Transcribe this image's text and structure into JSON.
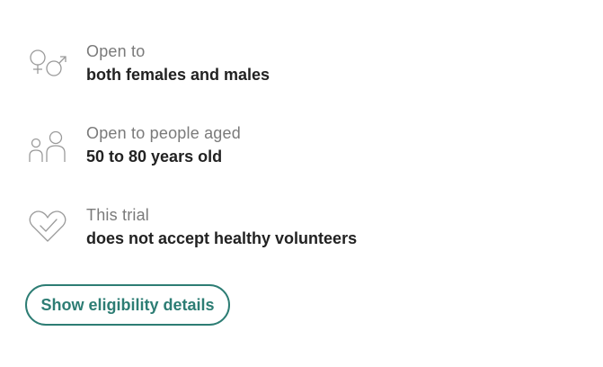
{
  "eligibility": {
    "items": [
      {
        "icon": "gender-icon",
        "label": "Open to",
        "value": "both females and males"
      },
      {
        "icon": "people-icon",
        "label": "Open to people aged",
        "value": "50 to 80 years old"
      },
      {
        "icon": "heart-check-icon",
        "label": "This trial",
        "value": "does not accept healthy volunteers"
      }
    ],
    "button_label": "Show eligibility details",
    "colors": {
      "accent": "#2d7d74",
      "label": "#7a7a7a",
      "value": "#222222",
      "icon": "#9a9a9a"
    }
  }
}
